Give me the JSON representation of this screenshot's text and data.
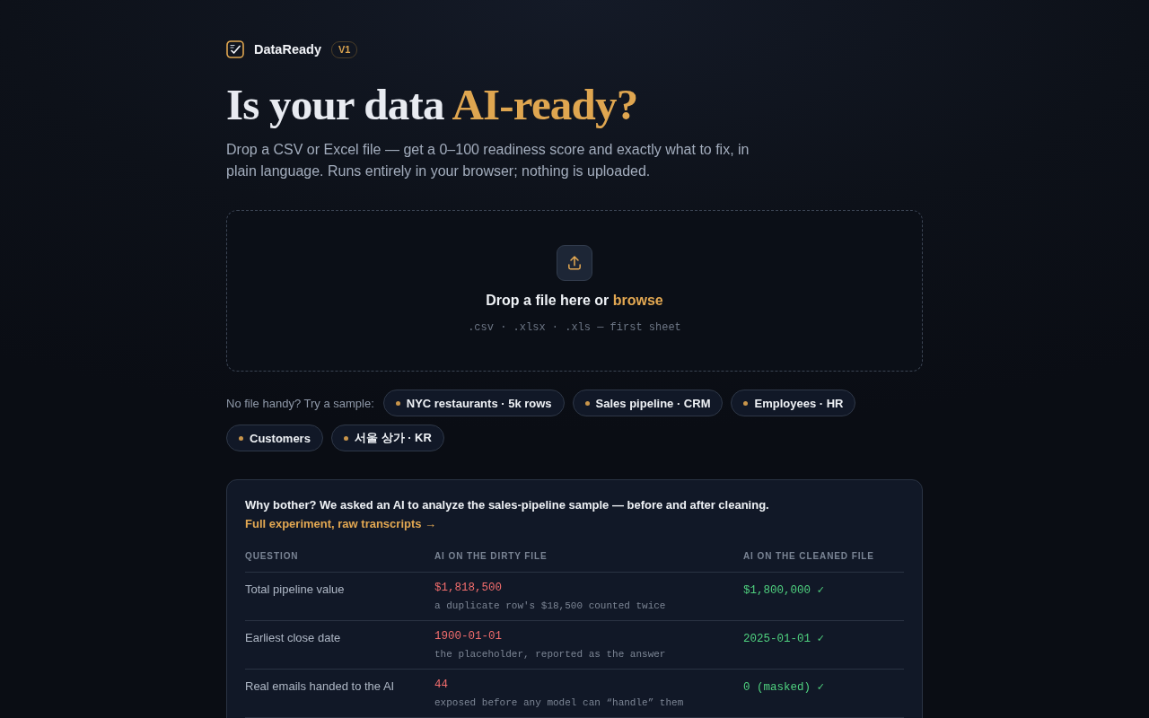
{
  "brand": {
    "name": "DataReady",
    "badge": "V1"
  },
  "hero": {
    "title": "Is your data",
    "title_highlight": "AI-ready?",
    "subtitle": "Drop a CSV or Excel file — get a 0–100 readiness score and exactly what to fix, in plain language. Runs entirely in your browser; nothing is uploaded."
  },
  "dropzone": {
    "prompt": "Drop a file here or",
    "link": "browse",
    "hint": ".csv · .xlsx · .xls — first sheet"
  },
  "samples": {
    "label": "No file handy? Try a sample:",
    "items": [
      "NYC restaurants · 5k rows",
      "Sales pipeline · CRM",
      "Employees · HR",
      "Customers",
      "서울 상가 · KR"
    ]
  },
  "comparison": {
    "intro": "Why bother? We asked an AI to analyze the sales-pipeline sample — before and after cleaning.",
    "link": "Full experiment, raw transcripts →",
    "columns": [
      "QUESTION",
      "AI ON THE DIRTY FILE",
      "AI ON THE CLEANED FILE"
    ],
    "rows": [
      {
        "question": "Total pipeline value",
        "dirty_value": "$1,818,500",
        "dirty_note": "a duplicate row's $18,500 counted twice",
        "clean_value": "$1,800,000 ✓"
      },
      {
        "question": "Earliest close date",
        "dirty_value": "1900-01-01",
        "dirty_note": "the placeholder, reported as the answer",
        "clean_value": "2025-01-01 ✓"
      },
      {
        "question": "Real emails handed to the AI",
        "dirty_value": "44",
        "dirty_note": "exposed before any model can “handle” them",
        "clean_value": "0 (masked) ✓"
      }
    ]
  }
}
